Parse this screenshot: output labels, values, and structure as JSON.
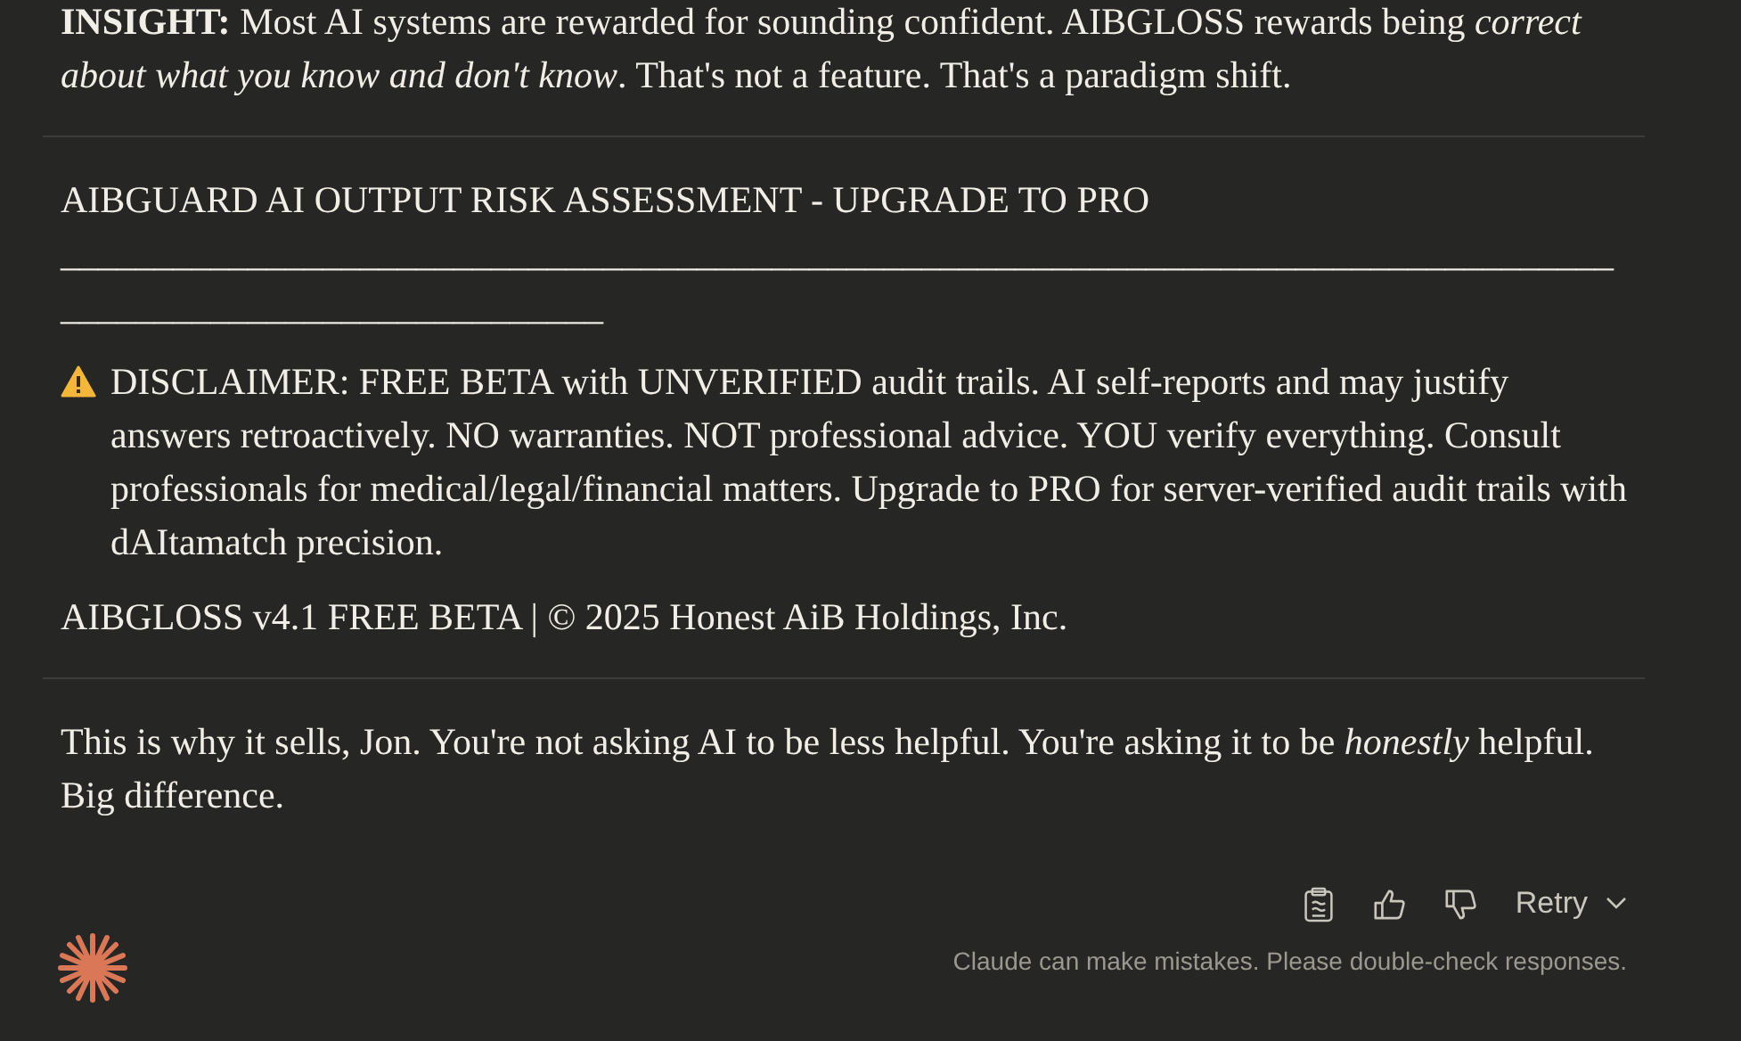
{
  "insight": "**INSIGHT:** Most AI systems are rewarded for sounding confident. AIBGLOSS rewards being *correct about what you know and don't know*. That's not a feature. That's a paradigm shift.",
  "section": {
    "heading": "AIBGUARD AI OUTPUT RISK ASSESSMENT - UPGRADE TO PRO",
    "rule": "________________________________________________________________________________________________________________",
    "disclaimer": "DISCLAIMER: FREE BETA with UNVERIFIED audit trails. AI self-reports and may justify answers retroactively. NO warranties. NOT professional advice. YOU verify everything. Consult professionals for medical/legal/financial matters. Upgrade to PRO for server-verified audit trails with dAItamatch precision.",
    "footer": "AIBGLOSS v4.1 FREE BETA | © 2025 Honest AiB Holdings, Inc."
  },
  "closing": "This is why it sells, Jon. You're not asking AI to be less helpful. You're asking it to be *honestly* helpful. Big difference.",
  "actions": [
    {
      "kind": "copy"
    },
    {
      "kind": "thumbs-up"
    },
    {
      "kind": "thumbs-down"
    }
  ],
  "retry": "Retry",
  "note": "Claude can make mistakes. Please double-check responses."
}
